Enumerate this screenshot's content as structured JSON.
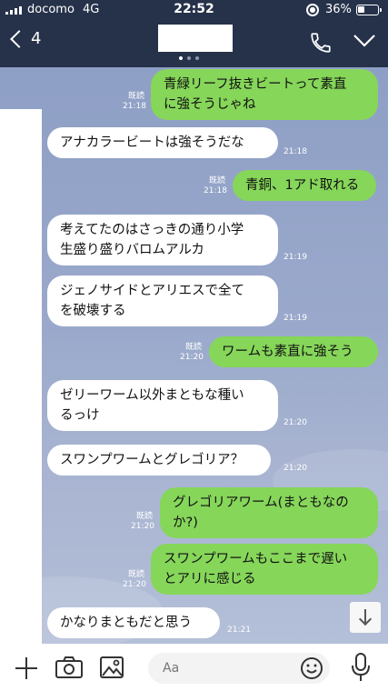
{
  "status": {
    "carrier": "docomo",
    "network": "4G",
    "time": "22:52",
    "battery": "36%",
    "battery_level": 0.36
  },
  "header": {
    "back_count": "4",
    "page_dots": 3,
    "active_dot": 0
  },
  "messages": [
    {
      "side": "out",
      "lines": [
        "青緑リーフ抜きビートって素直",
        "に強そうじゃね"
      ],
      "read": "既読",
      "time": "21:18"
    },
    {
      "side": "in",
      "lines": [
        "アナカラービートは強そうだな"
      ],
      "time": "21:18"
    },
    {
      "side": "out",
      "lines": [
        "青銅、1アド取れる"
      ],
      "read": "既読",
      "time": "21:18"
    },
    {
      "side": "in",
      "lines": [
        "考えてたのはさっきの通り小学",
        "生盛り盛りバロムアルカ"
      ],
      "time": "21:19"
    },
    {
      "side": "in",
      "lines": [
        "ジェノサイドとアリエスで全て",
        "を破壊する"
      ],
      "time": "21:19"
    },
    {
      "side": "out",
      "lines": [
        "ワームも素直に強そう"
      ],
      "read": "既読",
      "time": "21:20"
    },
    {
      "side": "in",
      "lines": [
        "ゼリーワーム以外まともな種い",
        "るっけ"
      ],
      "time": "21:20"
    },
    {
      "side": "in",
      "lines": [
        "スワンプワームとグレゴリア？"
      ],
      "time": "21:20"
    },
    {
      "side": "out",
      "lines": [
        "グレゴリアワーム(まともなの",
        "か?)"
      ],
      "read": "既読",
      "time": "21:20"
    },
    {
      "side": "out",
      "lines": [
        "スワンプワームもここまで遅い",
        "とアリに感じる"
      ],
      "read": "既読",
      "time": "21:20"
    },
    {
      "side": "in",
      "lines": [
        "かなりまともだと思う"
      ],
      "time": "21:21"
    }
  ],
  "input": {
    "placeholder": "Aa"
  },
  "icons": {
    "back": "chevron-left-icon",
    "phone": "phone-icon",
    "menu": "chevron-down-icon",
    "plus": "plus-icon",
    "camera": "camera-icon",
    "image": "image-icon",
    "emoji": "emoji-icon",
    "mic": "mic-icon",
    "scroll": "arrow-down-icon"
  },
  "colors": {
    "header": "#26324a",
    "out_bubble": "#86d65a",
    "in_bubble": "#ffffff",
    "chat_bg": "#9aa9cb"
  }
}
